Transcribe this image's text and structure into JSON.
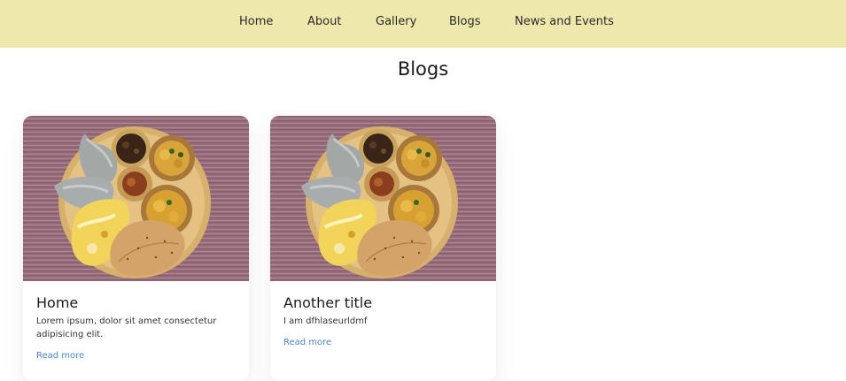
{
  "nav": {
    "items": [
      {
        "label": "Home"
      },
      {
        "label": "About"
      },
      {
        "label": "Gallery"
      },
      {
        "label": "Blogs"
      },
      {
        "label": "News and Events"
      }
    ]
  },
  "page": {
    "title": "Blogs"
  },
  "cards": [
    {
      "image_alt": "Plate of food",
      "title": "Home",
      "text": "Lorem ipsum, dolor sit amet consectetur adipisicing elit.",
      "link_label": "Read more"
    },
    {
      "image_alt": "Plate of food",
      "title": "Another title",
      "text": "I am dfhlaseurldmf",
      "link_label": "Read more"
    }
  ],
  "colors": {
    "nav_background": "#efe8ad",
    "link": "#4a86c8"
  }
}
